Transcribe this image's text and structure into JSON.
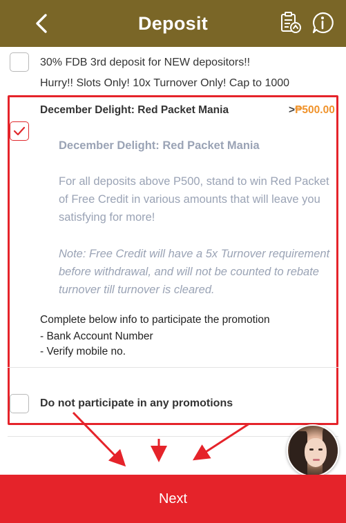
{
  "header": {
    "title": "Deposit",
    "back_icon": "chevron-left-icon",
    "history_icon": "clipboard-history-icon",
    "info_icon": "info-icon",
    "bg_color": "#7a6627"
  },
  "promotions": [
    {
      "checked": false,
      "title": "30% FDB 3rd deposit for NEW depositors!!",
      "subtitle": "Hurry!! Slots Only! 10x Turnover Only! Cap to 1000"
    },
    {
      "checked": true,
      "title": "December Delight: Red Packet Mania",
      "amount_prefix": ">",
      "amount": "₱500.00",
      "description_title": "December Delight: Red Packet Mania",
      "description": "For all deposits above P500, stand to win Red Packet of Free Credit in various amounts that will leave you satisfying for more!",
      "note": "Note: Free Credit will have a 5x Turnover requirement before withdrawal, and will not be counted to rebate turnover till turnover is cleared.",
      "requirements_intro": "Complete below info to participate the promotion",
      "requirements": [
        "- Bank Account Number",
        "- Verify mobile no."
      ]
    },
    {
      "checked": false,
      "title": "Do not participate in any promotions"
    }
  ],
  "next_button": {
    "label": "Next"
  },
  "colors": {
    "accent": "#e5232a",
    "amount": "#f0932b",
    "muted_text": "#9aa3b5"
  }
}
